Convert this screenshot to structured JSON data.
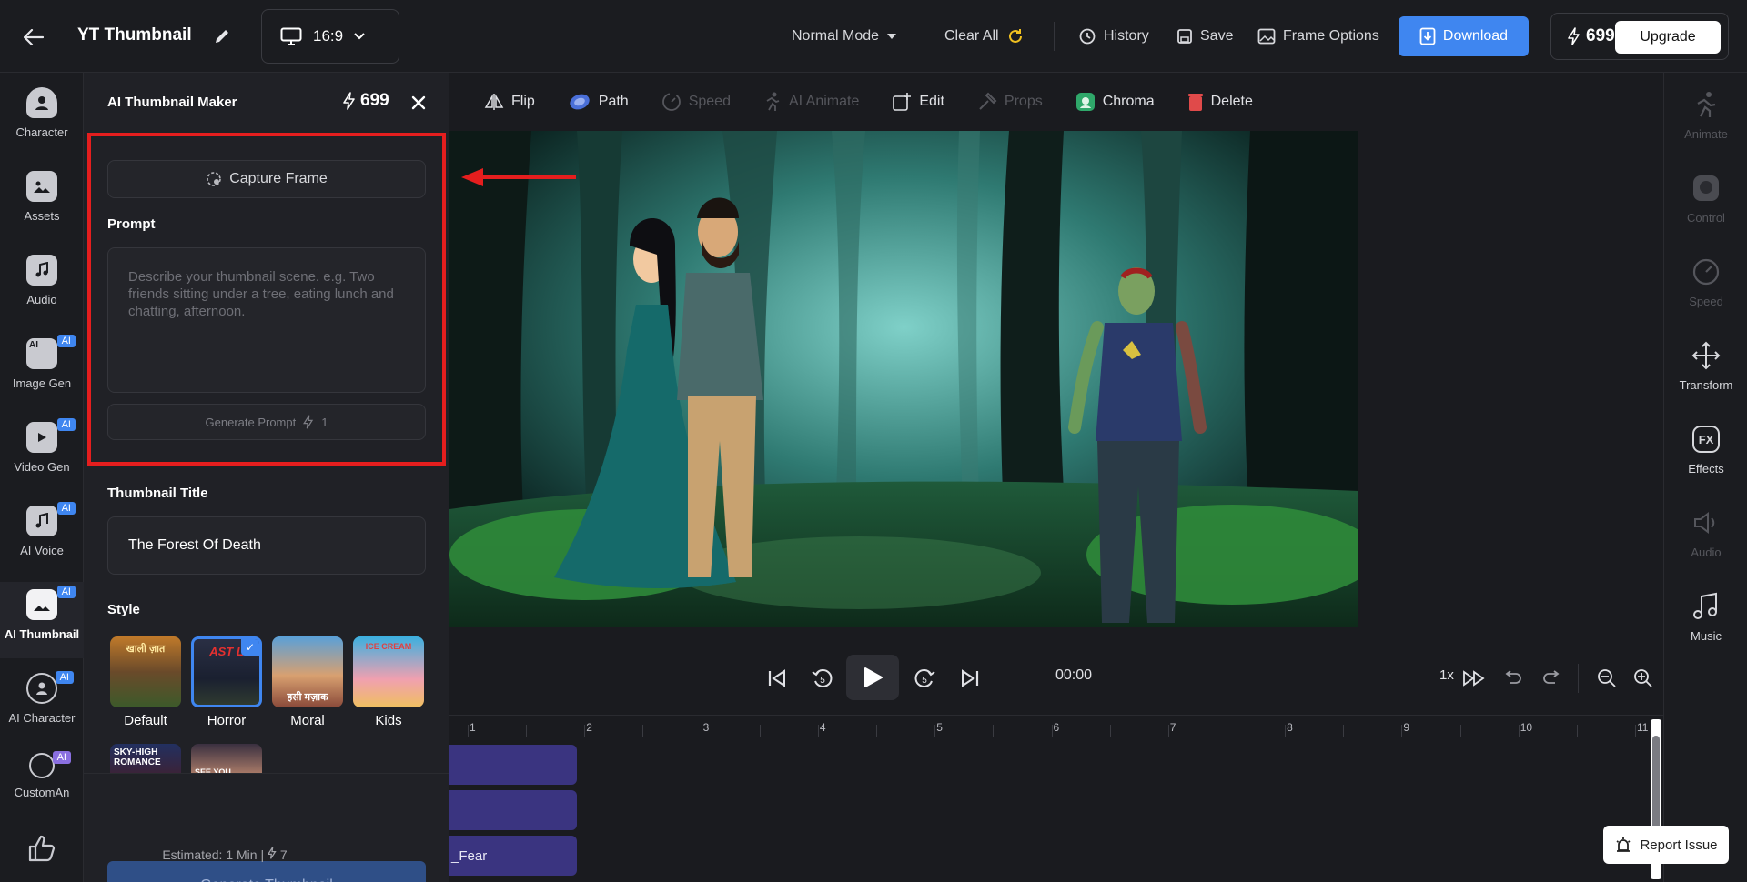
{
  "header": {
    "title": "YT Thumbnail",
    "ratio": "16:9",
    "mode": "Normal Mode",
    "clear_all": "Clear All",
    "history": "History",
    "save": "Save",
    "frame_options": "Frame Options",
    "download": "Download",
    "credits": "699",
    "upgrade": "Upgrade"
  },
  "left_rail": {
    "items": [
      {
        "label": "Character"
      },
      {
        "label": "Assets"
      },
      {
        "label": "Audio"
      },
      {
        "label": "Image Gen",
        "badge": "AI"
      },
      {
        "label": "Video Gen",
        "badge": "AI"
      },
      {
        "label": "AI Voice",
        "badge": "AI"
      },
      {
        "label": "AI Thumbnail",
        "badge": "AI"
      },
      {
        "label": "AI Character",
        "badge": "AI"
      },
      {
        "label": "CustomAn",
        "badge": "AI"
      }
    ]
  },
  "panel": {
    "title": "AI Thumbnail Maker",
    "credits": "699",
    "capture_frame": "Capture Frame",
    "prompt_label": "Prompt",
    "prompt_placeholder": "Describe your thumbnail scene. e.g. Two friends sitting under a tree, eating lunch and chatting, afternoon.",
    "generate_prompt": "Generate Prompt",
    "generate_prompt_cost": "1",
    "thumbnail_title_label": "Thumbnail Title",
    "thumbnail_title_value": "The Forest Of Death",
    "style_label": "Style",
    "styles": [
      {
        "name": "Default",
        "thumb_text": "खाली ज़ात"
      },
      {
        "name": "Horror",
        "thumb_text": "AST L"
      },
      {
        "name": "Moral",
        "thumb_text": "हसी मज़ाक"
      },
      {
        "name": "Kids",
        "thumb_text": "ICE CREAM"
      }
    ],
    "styles_row2": [
      {
        "thumb_text": "SKY-HIGH ROMANCE"
      },
      {
        "thumb_text": "SEE YOU"
      }
    ],
    "generate_thumbnail": "Generate Thumbnail",
    "estimated": "Estimated: 1 Min",
    "estimated_cost": "7"
  },
  "edit_toolbar": {
    "flip": "Flip",
    "path": "Path",
    "speed": "Speed",
    "ai_animate": "AI Animate",
    "edit": "Edit",
    "props": "Props",
    "chroma": "Chroma",
    "delete": "Delete"
  },
  "right_rail": {
    "items": [
      {
        "label": "Animate"
      },
      {
        "label": "Control"
      },
      {
        "label": "Speed"
      },
      {
        "label": "Transform"
      },
      {
        "label": "Effects"
      },
      {
        "label": "Audio"
      },
      {
        "label": "Music"
      }
    ]
  },
  "playback": {
    "time": "00:00",
    "speed": "1x"
  },
  "timeline": {
    "ticks": [
      "1",
      "2",
      "3",
      "4",
      "5",
      "6",
      "7",
      "8",
      "9",
      "10",
      "11"
    ],
    "clips": [
      "",
      "",
      "_Fear"
    ]
  },
  "report_issue": "Report Issue",
  "colors": {
    "accent": "#3f86f0",
    "highlight": "#e51e1e",
    "clip": "#3a3480"
  }
}
